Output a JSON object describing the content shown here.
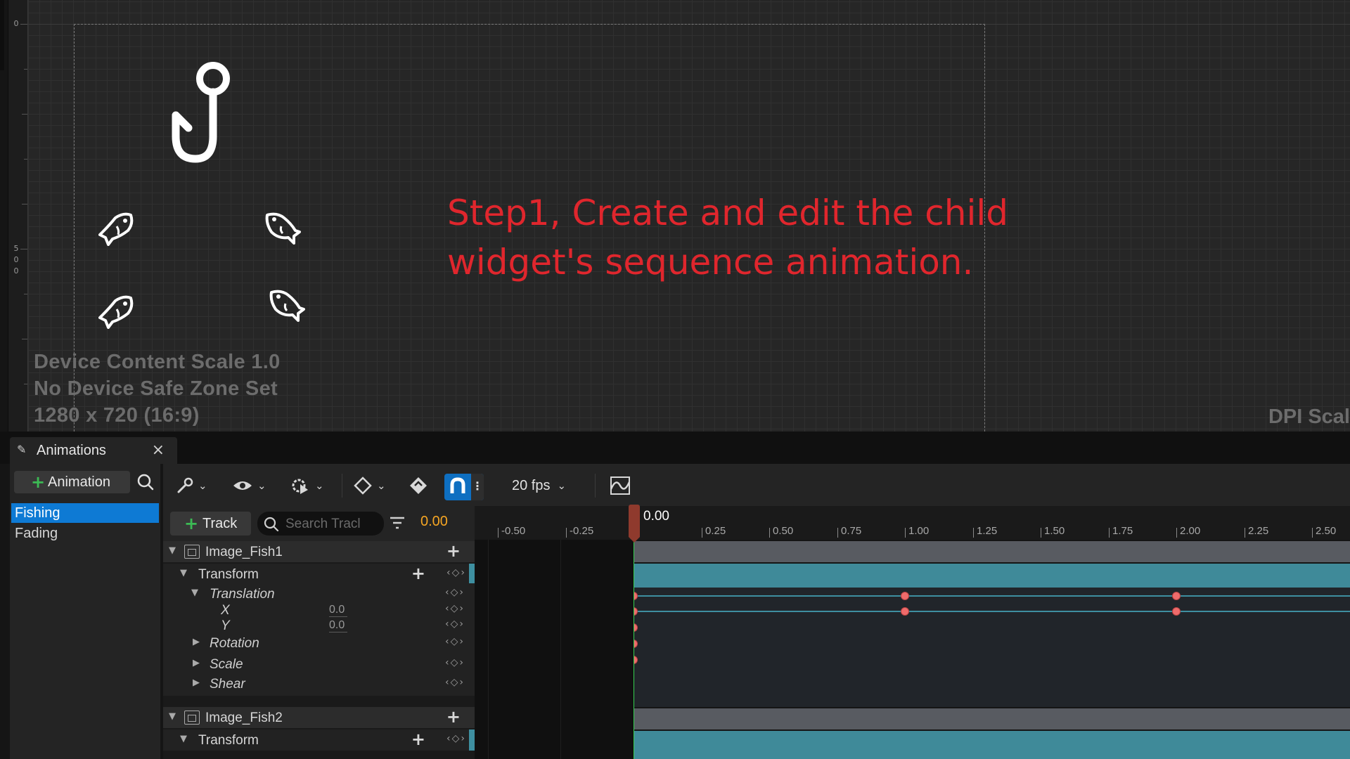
{
  "viewport": {
    "ruler_labels": [
      "0",
      "5\n0\n0"
    ],
    "step_text": "Step1, Create and edit the child widget's sequence animation.",
    "device_info": [
      "Device Content Scale 1.0",
      "No Device Safe Zone Set",
      "1280 x 720 (16:9)"
    ],
    "dpi_label": "DPI Scal"
  },
  "panel": {
    "tab_label": "Animations",
    "tab_close": "×",
    "add_animation_label": "Animation",
    "animations": [
      {
        "name": "Fishing",
        "selected": true
      },
      {
        "name": "Fading",
        "selected": false
      }
    ]
  },
  "toolbar": {
    "fps_label": "20 fps"
  },
  "tracks_header": {
    "add_track_label": "Track",
    "search_placeholder": "Search Tracl",
    "current_time": "0.00"
  },
  "outliner": {
    "rows": [
      {
        "kind": "object",
        "label": "Image_Fish1"
      },
      {
        "kind": "section",
        "label": "Transform"
      },
      {
        "kind": "group",
        "label": "Translation",
        "expanded": true
      },
      {
        "kind": "channel",
        "label": "X",
        "value": "0.0"
      },
      {
        "kind": "channel",
        "label": "Y",
        "value": "0.0"
      },
      {
        "kind": "group",
        "label": "Rotation",
        "expanded": false
      },
      {
        "kind": "group",
        "label": "Scale",
        "expanded": false
      },
      {
        "kind": "group",
        "label": "Shear",
        "expanded": false
      },
      {
        "kind": "object",
        "label": "Image_Fish2"
      },
      {
        "kind": "section",
        "label": "Transform"
      }
    ]
  },
  "timeline": {
    "playhead_label": "0.00",
    "ticks": [
      "-0.50",
      "-0.25",
      "0.25",
      "0.50",
      "0.75",
      "1.00",
      "1.25",
      "1.50",
      "1.75",
      "2.00",
      "2.25",
      "2.50"
    ],
    "tick_values": [
      -0.5,
      -0.25,
      0.25,
      0.5,
      0.75,
      1.0,
      1.25,
      1.5,
      1.75,
      2.0,
      2.25,
      2.5
    ],
    "keyframe_times": [
      0.0,
      1.0,
      2.0
    ],
    "accent_color": "#0e7ad4",
    "key_color": "#ef6b6b",
    "section_color": "#3f8a99"
  }
}
